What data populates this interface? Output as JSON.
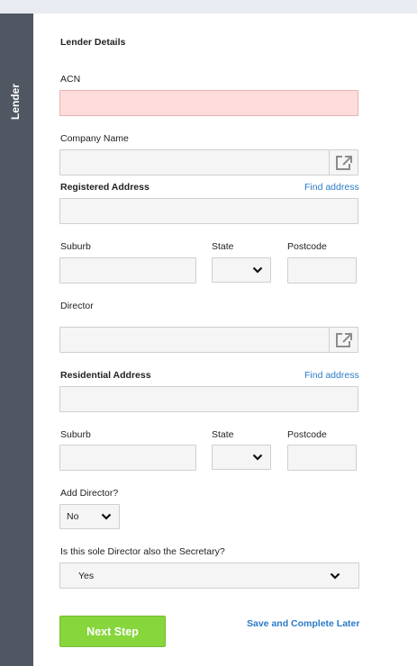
{
  "sidebar": {
    "label": "Lender"
  },
  "form": {
    "section_title": "Lender Details",
    "acn": {
      "label": "ACN",
      "value": ""
    },
    "company_name": {
      "label": "Company Name",
      "value": ""
    },
    "registered_address": {
      "label": "Registered Address",
      "find_link": "Find address",
      "value": ""
    },
    "registered_suburb": {
      "label": "Suburb",
      "value": ""
    },
    "registered_state": {
      "label": "State",
      "value": ""
    },
    "registered_postcode": {
      "label": "Postcode",
      "value": ""
    },
    "director": {
      "label": "Director",
      "value": ""
    },
    "residential_address": {
      "label": "Residential Address",
      "find_link": "Find address",
      "value": ""
    },
    "residential_suburb": {
      "label": "Suburb",
      "value": ""
    },
    "residential_state": {
      "label": "State",
      "value": ""
    },
    "residential_postcode": {
      "label": "Postcode",
      "value": ""
    },
    "add_director": {
      "label": "Add Director?",
      "value": "No"
    },
    "sole_director_secretary": {
      "label": "Is this sole Director also the Secretary?",
      "value": "Yes"
    }
  },
  "actions": {
    "next_label": "Next Step",
    "save_later_label": "Save and Complete Later"
  },
  "colors": {
    "sidebar": "#505662",
    "error_field": "#ffdcdc",
    "link": "#2b7bc8",
    "primary_button": "#86d63c"
  },
  "icons": {
    "external": "external-link-icon",
    "chevron": "chevron-down-icon"
  }
}
